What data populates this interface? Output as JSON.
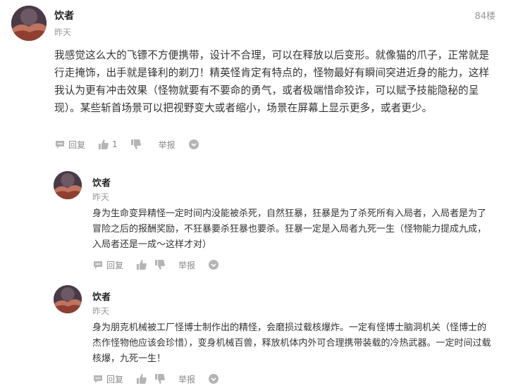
{
  "main_comment": {
    "author": "饮者",
    "date": "昨天",
    "floor": "84楼",
    "text": "我感觉这么大的飞镖不方便携带，设计不合理，可以在释放以后变形。就像猫的爪子，正常就是行走掩饰，出手就是锋利的剃刀！精英怪肯定有特点的，怪物最好有瞬间突进近身的能力，这样我认为更有冲击效果（怪物就要有不要命的勇气，或者极端惜命狡诈，可以赋予技能隐秘的呈现）。某些斩首场景可以把视野变大或者缩小，场景在屏幕上显示更多，或者更少。",
    "actions": {
      "reply": "回复",
      "like_count": "1",
      "report": "举报"
    }
  },
  "replies": [
    {
      "author": "饮者",
      "date": "昨天",
      "text": "身为生命变异精怪一定时间内没能被杀死，自然狂暴，狂暴是为了杀死所有入局者，入局者是为了冒险之后的报酬奖励，不狂暴要杀狂暴也要杀。狂暴一定是入局者九死一生（怪物能力提成九成，入局者还是一成～这样才对）",
      "actions": {
        "reply": "回复",
        "report": "举报"
      }
    },
    {
      "author": "饮者",
      "date": "昨天",
      "text": "身为朋克机械被工厂怪博士制作出的精怪，会磨损过载核爆炸。一定有怪博士脑洞机关（怪博士的杰作怪物他应该会珍惜），变身机械百兽，释放机体内外可合理携带装载的冷热武器。一定时间过载核爆，九死一生！",
      "actions": {
        "reply": "回复",
        "report": "举报"
      }
    }
  ],
  "colors": {
    "text": "#333333",
    "meta": "#9a9a9a",
    "icon": "#b5b5b5"
  }
}
